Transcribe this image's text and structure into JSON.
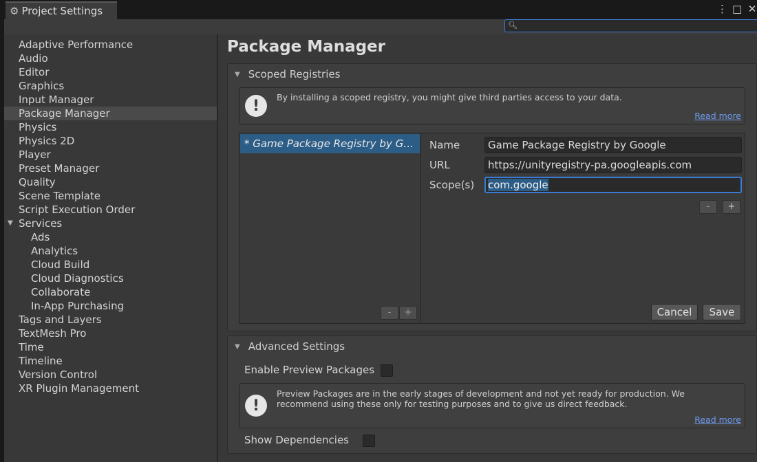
{
  "window": {
    "tab_title": "Project Settings",
    "menu_icon": "⋮",
    "maximize_icon": "□",
    "close_icon": "✕"
  },
  "search": {
    "value": ""
  },
  "sidebar": {
    "items": [
      {
        "label": "Adaptive Performance"
      },
      {
        "label": "Audio"
      },
      {
        "label": "Editor"
      },
      {
        "label": "Graphics"
      },
      {
        "label": "Input Manager"
      },
      {
        "label": "Package Manager",
        "selected": true
      },
      {
        "label": "Physics"
      },
      {
        "label": "Physics 2D"
      },
      {
        "label": "Player"
      },
      {
        "label": "Preset Manager"
      },
      {
        "label": "Quality"
      },
      {
        "label": "Scene Template"
      },
      {
        "label": "Script Execution Order"
      },
      {
        "label": "Services",
        "expanded": true
      },
      {
        "label": "Ads",
        "child": true
      },
      {
        "label": "Analytics",
        "child": true
      },
      {
        "label": "Cloud Build",
        "child": true
      },
      {
        "label": "Cloud Diagnostics",
        "child": true
      },
      {
        "label": "Collaborate",
        "child": true
      },
      {
        "label": "In-App Purchasing",
        "child": true
      },
      {
        "label": "Tags and Layers"
      },
      {
        "label": "TextMesh Pro"
      },
      {
        "label": "Time"
      },
      {
        "label": "Timeline"
      },
      {
        "label": "Version Control"
      },
      {
        "label": "XR Plugin Management"
      }
    ]
  },
  "main": {
    "title": "Package Manager",
    "scoped": {
      "header": "Scoped Registries",
      "warning": "By installing a scoped registry, you might give third parties access to your data.",
      "read_more": "Read more",
      "registry_item": "* Game Package Registry by Google",
      "list_minus": "-",
      "list_plus": "+",
      "name_label": "Name",
      "name_value": "Game Package Registry by Google",
      "url_label": "URL",
      "url_value": "https://unityregistry-pa.googleapis.com",
      "scopes_label": "Scope(s)",
      "scopes_value": "com.google",
      "scope_minus": "-",
      "scope_plus": "+",
      "cancel": "Cancel",
      "save": "Save"
    },
    "advanced": {
      "header": "Advanced Settings",
      "preview_label": "Enable Preview Packages",
      "preview_checked": false,
      "warning": "Preview Packages are in the early stages of development and not yet ready for production. We recommend using these only for testing purposes and to give us direct feedback.",
      "read_more": "Read more",
      "deps_label": "Show Dependencies",
      "deps_checked": false
    }
  },
  "colors": {
    "accent": "#3a7bd5",
    "selection": "#2c5d87",
    "link": "#6e9cf0"
  }
}
